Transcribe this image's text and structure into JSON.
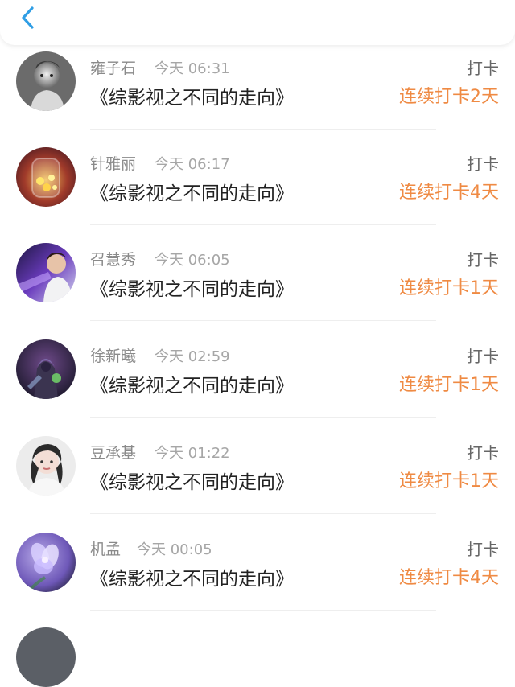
{
  "header": {
    "back_icon": "chevron-left-icon",
    "accent_color": "#2f9ee5"
  },
  "items": [
    {
      "name": "雍子石",
      "time": "今天 06:31",
      "title": "《综影视之不同的走向》",
      "status": "打卡",
      "streak": "连续打卡2天",
      "avatar_icon": "avatar-child-bw"
    },
    {
      "name": "针雅丽",
      "time": "今天 06:17",
      "title": "《综影视之不同的走向》",
      "status": "打卡",
      "streak": "连续打卡4天",
      "avatar_icon": "avatar-jar-lights"
    },
    {
      "name": "召慧秀",
      "time": "今天 06:05",
      "title": "《综影视之不同的走向》",
      "status": "打卡",
      "streak": "连续打卡1天",
      "avatar_icon": "avatar-man-purple"
    },
    {
      "name": "徐新曦",
      "time": "今天 02:59",
      "title": "《综影视之不同的走向》",
      "status": "打卡",
      "streak": "连续打卡1天",
      "avatar_icon": "avatar-armored-warrior"
    },
    {
      "name": "豆承基",
      "time": "今天 01:22",
      "title": "《综影视之不同的走向》",
      "status": "打卡",
      "streak": "连续打卡1天",
      "avatar_icon": "avatar-girl-portrait"
    },
    {
      "name": "机孟",
      "time": "今天 00:05",
      "title": "《综影视之不同的走向》",
      "status": "打卡",
      "streak": "连续打卡4天",
      "avatar_icon": "avatar-purple-flower"
    }
  ],
  "colors": {
    "streak": "#ef8a43",
    "name": "#8a8a8a",
    "title": "#222222"
  }
}
